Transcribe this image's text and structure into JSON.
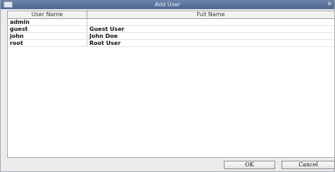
{
  "window": {
    "title": "Add User",
    "close_glyph": "×"
  },
  "table": {
    "columns": [
      "User Name",
      "Full Name"
    ],
    "rows": [
      {
        "user": "admin",
        "full": ""
      },
      {
        "user": "guest",
        "full": "Guest User"
      },
      {
        "user": "john",
        "full": "John Doe"
      },
      {
        "user": "root",
        "full": "Root User"
      }
    ]
  },
  "buttons": {
    "ok": "OK",
    "cancel": "Cancel"
  }
}
